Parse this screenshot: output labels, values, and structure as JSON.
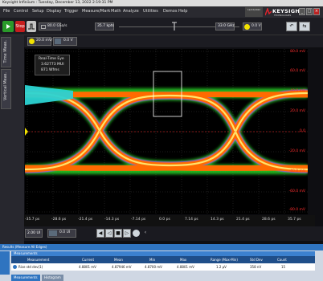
{
  "window": {
    "title": "Keysight Infiniium : Tuesday, December 13, 2022 2:19:31 PM",
    "datebox": "12/13/2022"
  },
  "menu": [
    "File",
    "Control",
    "Setup",
    "Display",
    "Trigger",
    "Measure/Mark",
    "Math",
    "Analyze",
    "Utilities",
    "Demos",
    "Help"
  ],
  "brand": {
    "name": "KEYSIGHT",
    "sub": "TECHNOLOGIES"
  },
  "toolbar": {
    "run": "Run",
    "stop": "Stop",
    "single": "Single",
    "sample_rate": "80.0 GSa/s",
    "points": "35.7 kpts",
    "bandwidth": "33.0 GHz",
    "trig_level": "0.0 V",
    "ch_scale": "20.0 mV/",
    "ch_offset": "0.0 V",
    "time_scale": "2.00 UI",
    "time_offset": "0.0 UI"
  },
  "sidebar": {
    "tabs": [
      "Time Meas.",
      "Vertical Meas."
    ]
  },
  "overlay": {
    "title": "Real-Time Eye",
    "ui": "3.62773 MUI",
    "wfms": "871 Wfms"
  },
  "axes": {
    "y_ticks": [
      "80.0 mV",
      "60.0 mV",
      "40.0 mV",
      "20.0 mV",
      "0.0",
      "-20.0 mV",
      "-40.0 mV",
      "-60.0 mV",
      "-80.0 mV"
    ],
    "x_ticks": [
      "-35.7 ps",
      "-28.6 ps",
      "-21.4 ps",
      "-14.3 ps",
      "-7.14 ps",
      "0.0 ps",
      "7.14 ps",
      "14.3 ps",
      "21.4 ps",
      "28.6 ps",
      "35.7 ps"
    ]
  },
  "measurements": {
    "panel_title": "Results  (Measure All Edges)",
    "section": "Measurements",
    "headers": [
      "Measurement",
      "Current",
      "Mean",
      "Min",
      "Max",
      "Range (Max-Min)",
      "Std Dev",
      "Count"
    ],
    "rows": [
      [
        "Rise std dev(1)",
        "4.8801 mV",
        "4.87946 mV",
        "4.8700 mV",
        "4.8801 mV",
        "1.2 μV",
        "358 nV",
        "15"
      ]
    ]
  },
  "bottom_tabs": [
    "Measurements",
    "Histogram"
  ],
  "colors": {
    "channel": "#f2e200",
    "trigger_line": "#ff2b2b",
    "eye_core": "#ff6a00",
    "eye_outer": "#27d327",
    "eye_edge": "#c045ff"
  }
}
